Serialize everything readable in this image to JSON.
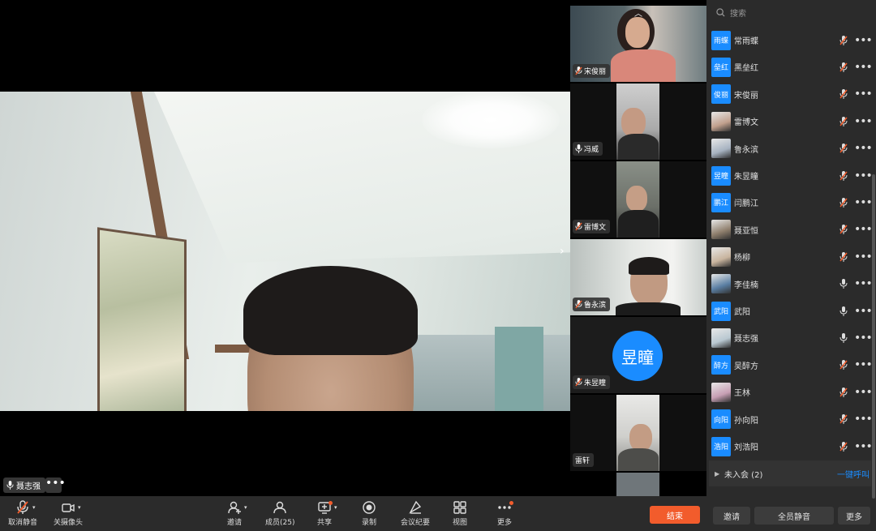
{
  "speaker": {
    "name": "聂志强",
    "more_label": "•••"
  },
  "gallery": {
    "next_arrow": "›",
    "scroll_up": "︿"
  },
  "thumbnails": [
    {
      "name": "宋俊丽",
      "mic": "muted"
    },
    {
      "name": "冯威",
      "mic": "on"
    },
    {
      "name": "雷博文",
      "mic": "muted"
    },
    {
      "name": "鲁永滨",
      "mic": "muted"
    },
    {
      "name": "朱昱瞳",
      "mic": "muted",
      "avatar_text": "昱瞳"
    },
    {
      "name": "雷轩",
      "mic": "none"
    }
  ],
  "panel": {
    "search_placeholder": "搜索",
    "members": [
      {
        "name": "常雨蝶",
        "avatar_text": "雨蝶",
        "avatar": "text",
        "mic": "muted"
      },
      {
        "name": "黑垒红",
        "avatar_text": "垒红",
        "avatar": "text",
        "mic": "muted"
      },
      {
        "name": "宋俊丽",
        "avatar_text": "俊丽",
        "avatar": "text",
        "mic": "muted"
      },
      {
        "name": "雷博文",
        "avatar_text": "",
        "avatar": "photo",
        "mic": "muted"
      },
      {
        "name": "鲁永滨",
        "avatar_text": "",
        "avatar": "photo",
        "mic": "muted"
      },
      {
        "name": "朱昱瞳",
        "avatar_text": "昱瞳",
        "avatar": "text",
        "mic": "muted"
      },
      {
        "name": "闫鹏江",
        "avatar_text": "鹏江",
        "avatar": "text",
        "mic": "muted"
      },
      {
        "name": "聂亚恒",
        "avatar_text": "",
        "avatar": "photo",
        "mic": "muted"
      },
      {
        "name": "杨柳",
        "avatar_text": "",
        "avatar": "photo",
        "mic": "muted"
      },
      {
        "name": "李佳楠",
        "avatar_text": "",
        "avatar": "photo",
        "mic": "on"
      },
      {
        "name": "武阳",
        "avatar_text": "武阳",
        "avatar": "text",
        "mic": "on"
      },
      {
        "name": "聂志强",
        "avatar_text": "",
        "avatar": "photo",
        "mic": "on"
      },
      {
        "name": "吴醉方",
        "avatar_text": "醉方",
        "avatar": "text",
        "mic": "muted"
      },
      {
        "name": "王林",
        "avatar_text": "",
        "avatar": "photo",
        "mic": "muted"
      },
      {
        "name": "孙向阳",
        "avatar_text": "向阳",
        "avatar": "text",
        "mic": "muted"
      },
      {
        "name": "刘浩阳",
        "avatar_text": "浩阳",
        "avatar": "text",
        "mic": "muted"
      }
    ],
    "not_joined_label": "未入会 (2)",
    "call_all": "一键呼叫",
    "invite": "邀请",
    "mute_all": "全员静音",
    "more": "更多"
  },
  "toolbar": {
    "unmute": "取消静音",
    "camera_off": "关摄像头",
    "invite": "邀请",
    "members": "成员(25)",
    "share": "共享",
    "record": "录制",
    "minutes": "会议纪要",
    "view": "视图",
    "more": "更多",
    "end": "结束"
  },
  "colors": {
    "accent": "#1a8cff",
    "end_button": "#f25c2c",
    "muted_mic": "#f25c2c"
  }
}
